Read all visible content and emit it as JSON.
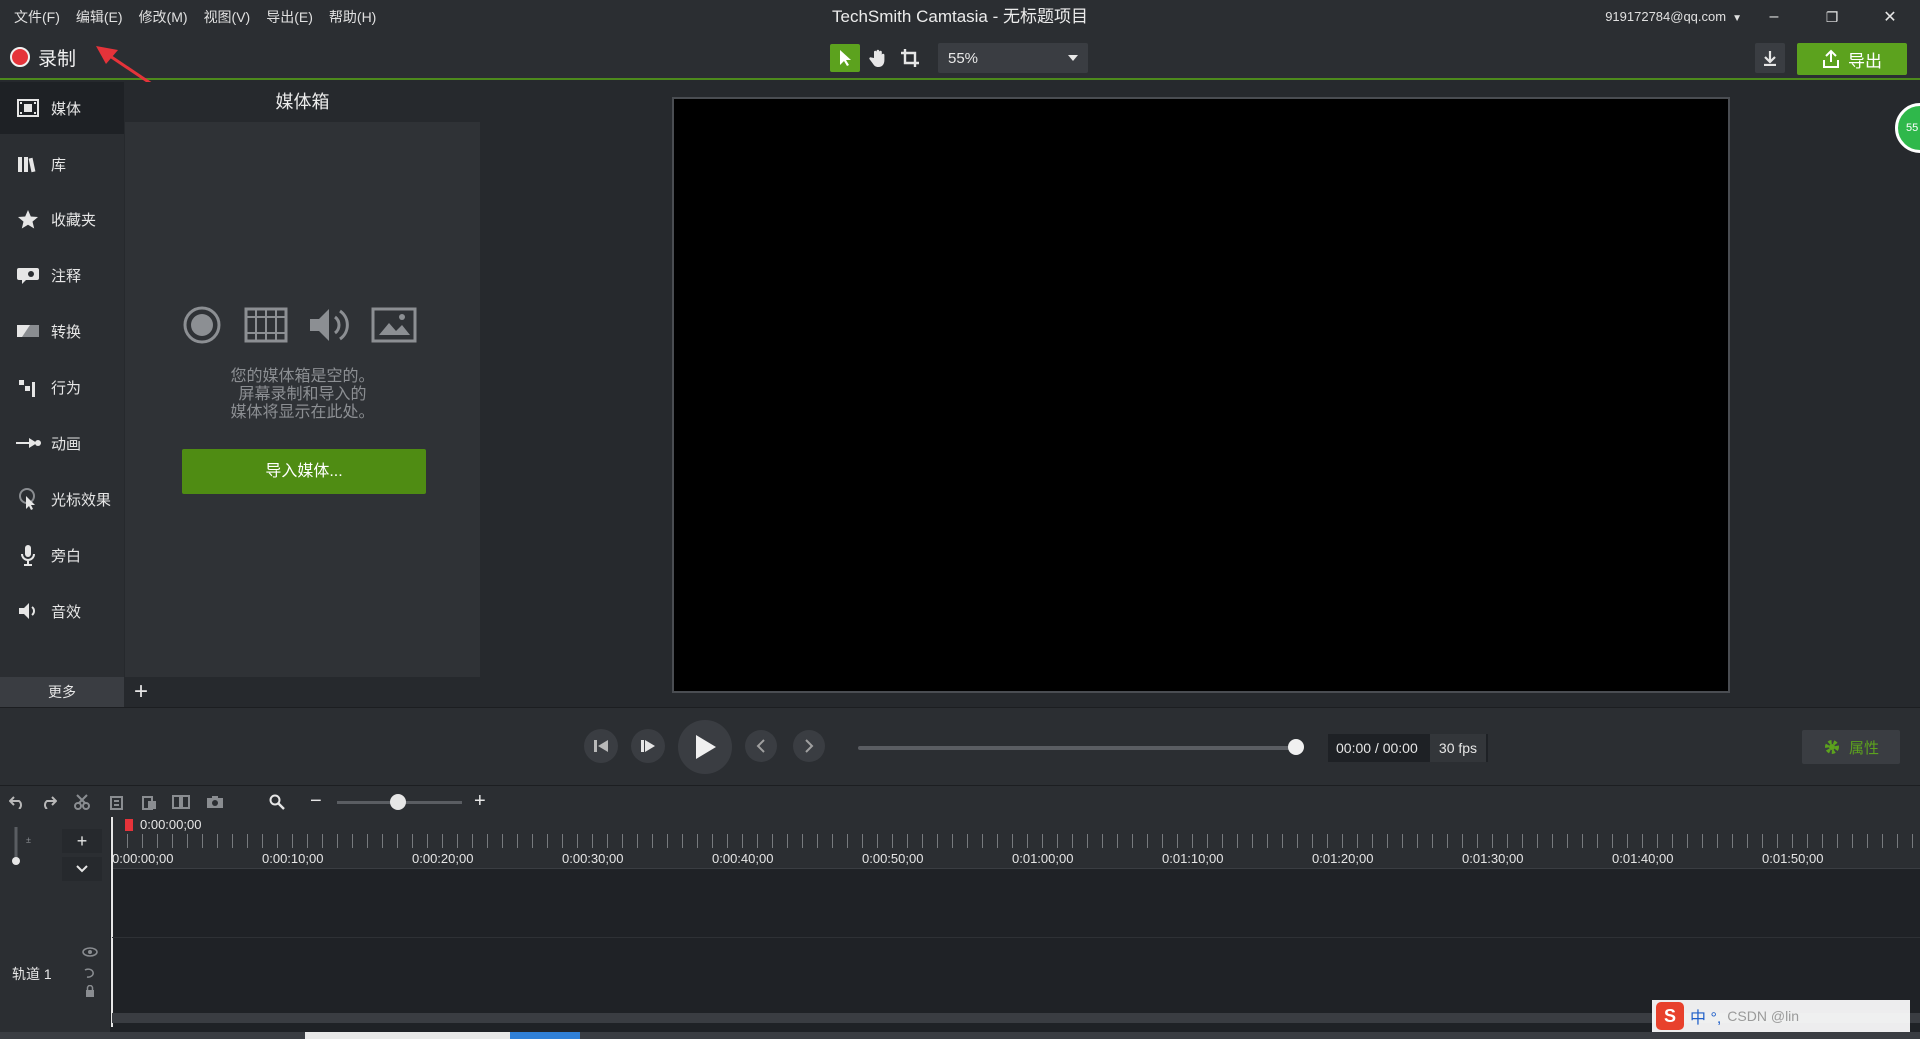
{
  "window": {
    "title": "TechSmith Camtasia - 无标题项目",
    "account": "919172784@qq.com",
    "controls": {
      "minimize": "–",
      "restore": "❐",
      "close": "✕"
    }
  },
  "menu": [
    "文件(F)",
    "编辑(E)",
    "修改(M)",
    "视图(V)",
    "导出(E)",
    "帮助(H)"
  ],
  "toolbar": {
    "record_label": "录制",
    "zoom_value": "55%",
    "export_label": "导出",
    "accent": "#5ca21e",
    "record_color": "#e5333a"
  },
  "sidebar": {
    "items": [
      {
        "label": "媒体",
        "icon": "filmstrip-icon"
      },
      {
        "label": "库",
        "icon": "library-icon"
      },
      {
        "label": "收藏夹",
        "icon": "star-icon"
      },
      {
        "label": "注释",
        "icon": "annotation-icon"
      },
      {
        "label": "转换",
        "icon": "transition-icon"
      },
      {
        "label": "行为",
        "icon": "behavior-icon"
      },
      {
        "label": "动画",
        "icon": "animation-icon"
      },
      {
        "label": "光标效果",
        "icon": "cursor-effect-icon"
      },
      {
        "label": "旁白",
        "icon": "microphone-icon"
      },
      {
        "label": "音效",
        "icon": "speaker-icon"
      }
    ],
    "more_label": "更多",
    "add_label": "+"
  },
  "media_bin": {
    "title": "媒体箱",
    "empty_lines": [
      "您的媒体箱是空的。",
      "屏幕录制和导入的",
      "媒体将显示在此处。"
    ],
    "import_label": "导入媒体..."
  },
  "canvas_badge": "55",
  "playback": {
    "timecode": "00:00 / 00:00",
    "fps": "30 fps",
    "properties_label": "属性",
    "scrub_position": 1.0
  },
  "timeline": {
    "playhead_time": "0:00:00;00",
    "ticks": [
      "0:00:00;00",
      "0:00:10;00",
      "0:00:20;00",
      "0:00:30;00",
      "0:00:40;00",
      "0:00:50;00",
      "0:01:00;00",
      "0:01:10;00",
      "0:01:20;00",
      "0:01:30;00",
      "0:01:40;00",
      "0:01:50;00"
    ],
    "track_name": "轨道 1",
    "zoom_minus": "−",
    "zoom_plus": "+",
    "zoom_level": 0.55
  },
  "ime": {
    "logo": "S",
    "text": "中 °,",
    "watermark": "CSDN @lin"
  }
}
